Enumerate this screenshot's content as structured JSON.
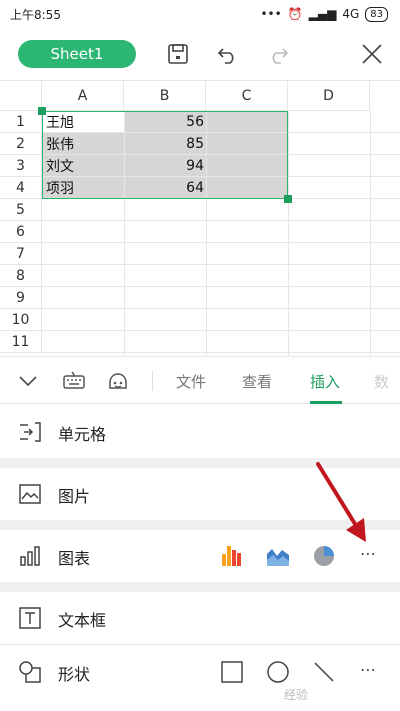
{
  "status_bar": {
    "time": "上午8:55",
    "network": "4G",
    "battery": "83"
  },
  "toolbar": {
    "sheet_name": "Sheet1"
  },
  "grid": {
    "columns": [
      "A",
      "B",
      "C",
      "D"
    ],
    "rows": [
      "1",
      "2",
      "3",
      "4",
      "5",
      "6",
      "7",
      "8",
      "9",
      "10",
      "11"
    ],
    "data": [
      {
        "name": "王旭",
        "score": "56"
      },
      {
        "name": "张伟",
        "score": "85"
      },
      {
        "name": "刘文",
        "score": "94"
      },
      {
        "name": "项羽",
        "score": "64"
      }
    ]
  },
  "tabs": [
    "文件",
    "查看",
    "插入",
    "数"
  ],
  "active_tab": "插入",
  "menu": {
    "cell": "单元格",
    "picture": "图片",
    "chart": "图表",
    "textbox": "文本框",
    "shape": "形状"
  },
  "colors": {
    "accent": "#2bb673",
    "selection": "#d6d6d6",
    "annotation_arrow": "#c0161d"
  },
  "watermark": "经验"
}
